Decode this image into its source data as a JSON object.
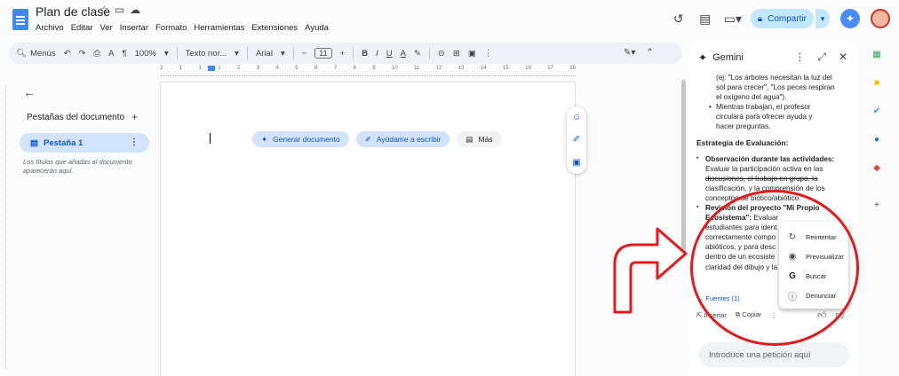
{
  "doc": {
    "title": "Plan de clase",
    "menu": [
      "Archivo",
      "Editar",
      "Ver",
      "Insertar",
      "Formato",
      "Herramientas",
      "Extensiones",
      "Ayuda"
    ]
  },
  "top_right": {
    "share_label": "Compartir"
  },
  "toolbar": {
    "search_label": "Menús",
    "zoom": "100%",
    "style": "Texto nor...",
    "font": "Arial",
    "font_size": "11"
  },
  "ruler": {
    "ticks": [
      "2",
      "1",
      "1",
      "1",
      "2",
      "3",
      "4",
      "5",
      "6",
      "7",
      "8",
      "9",
      "10",
      "11",
      "12",
      "13",
      "14",
      "15",
      "16",
      "17",
      "18"
    ]
  },
  "left_panel": {
    "title": "Pestañas del documento",
    "tab_label": "Pestaña 1",
    "hint": "Los títulos que añadas al documento aparecerán aquí."
  },
  "page": {
    "chips": {
      "generate": "Generar documento",
      "help_write": "Ayúdame a escribir",
      "more": "Más"
    }
  },
  "gemini": {
    "title": "Gemini",
    "lines": {
      "l1": "(ej: \"Los árboles necesitan la luz del",
      "l2": "sol para crecer\", \"Los peces respiran",
      "l3": "el oxígeno del agua\").",
      "l4": "Mientras trabajan, el profesor",
      "l5": "circulará para ofrecer ayuda y",
      "l6": "hacer preguntas."
    },
    "eval_heading": "Estrategia de Evaluación:",
    "obs_title": "Observación durante las actividades:",
    "obs_l1": "Evaluar la participación activa en las",
    "obs_l2": "discusiones, el trabajo en grupo, la",
    "obs_l3": "clasificación, y la comprensión de los",
    "obs_l4": "conceptos de biótico/abiótico.",
    "proj_title_a": "Revisión del proyecto \"Mi Propio",
    "proj_title_b": "Ecosistema\":",
    "proj_rest": " Evaluar",
    "proj_l2": "estudiantes para ident",
    "proj_l3": "correctamente compo",
    "proj_l4": "abióticos, y para desc",
    "proj_l5": "dentro de un ecosiste",
    "proj_l6": "claridad del dibujo y la",
    "sources": "Fuentes (1)",
    "insert": "Insertar",
    "copy": "Copiar",
    "prompt_placeholder": "Introduce una petición aquí"
  },
  "context_menu": {
    "retry": "Reintentar",
    "preview": "Previsualizar",
    "search": "Buscar",
    "report": "Denunciar"
  },
  "annotations": {
    "circle_color": "#e8191a",
    "arrow_color": "#e8191a"
  }
}
